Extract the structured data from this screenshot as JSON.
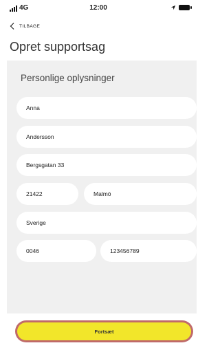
{
  "status_bar": {
    "network": "4G",
    "time": "12:00",
    "icons": [
      "signal-bars-icon",
      "location-arrow-icon",
      "battery-icon"
    ]
  },
  "nav": {
    "back_label": "TILBAGE"
  },
  "page": {
    "title": "Opret supportsag"
  },
  "form": {
    "section_title": "Personlige oplysninger",
    "first_name": "Anna",
    "last_name": "Andersson",
    "street": "Bergsgatan 33",
    "postal_code": "21422",
    "city": "Malmö",
    "country": "Sverige",
    "phone_prefix": "0046",
    "phone_number": "123456789"
  },
  "actions": {
    "continue_label": "Fortsæt"
  },
  "colors": {
    "accent_button": "#f2e62a",
    "button_ring": "#c06a6a",
    "panel_bg": "#f0f0f0"
  }
}
